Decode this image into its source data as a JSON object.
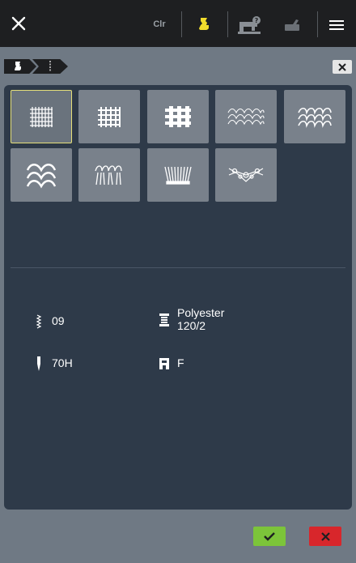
{
  "topbar": {
    "clear_label": "Clr"
  },
  "fabrics": [
    {
      "icon": "fine-woven-fabric-icon",
      "selected": true
    },
    {
      "icon": "medium-woven-fabric-icon",
      "selected": false
    },
    {
      "icon": "heavy-woven-fabric-icon",
      "selected": false
    },
    {
      "icon": "fine-knit-fabric-icon",
      "selected": false
    },
    {
      "icon": "medium-knit-fabric-icon",
      "selected": false
    },
    {
      "icon": "heavy-knit-fabric-icon",
      "selected": false
    },
    {
      "icon": "fleece-fabric-icon",
      "selected": false
    },
    {
      "icon": "velvet-fabric-icon",
      "selected": false
    },
    {
      "icon": "lace-fabric-icon",
      "selected": false
    }
  ],
  "recommendations": {
    "stitch_length": "09",
    "thread_type": "Polyester",
    "thread_weight": "120/2",
    "needle": "70H",
    "presser_foot": "F"
  },
  "colors": {
    "ok": "#7cc43a",
    "cancel": "#d8262b",
    "accent": "#f2dc2c"
  }
}
